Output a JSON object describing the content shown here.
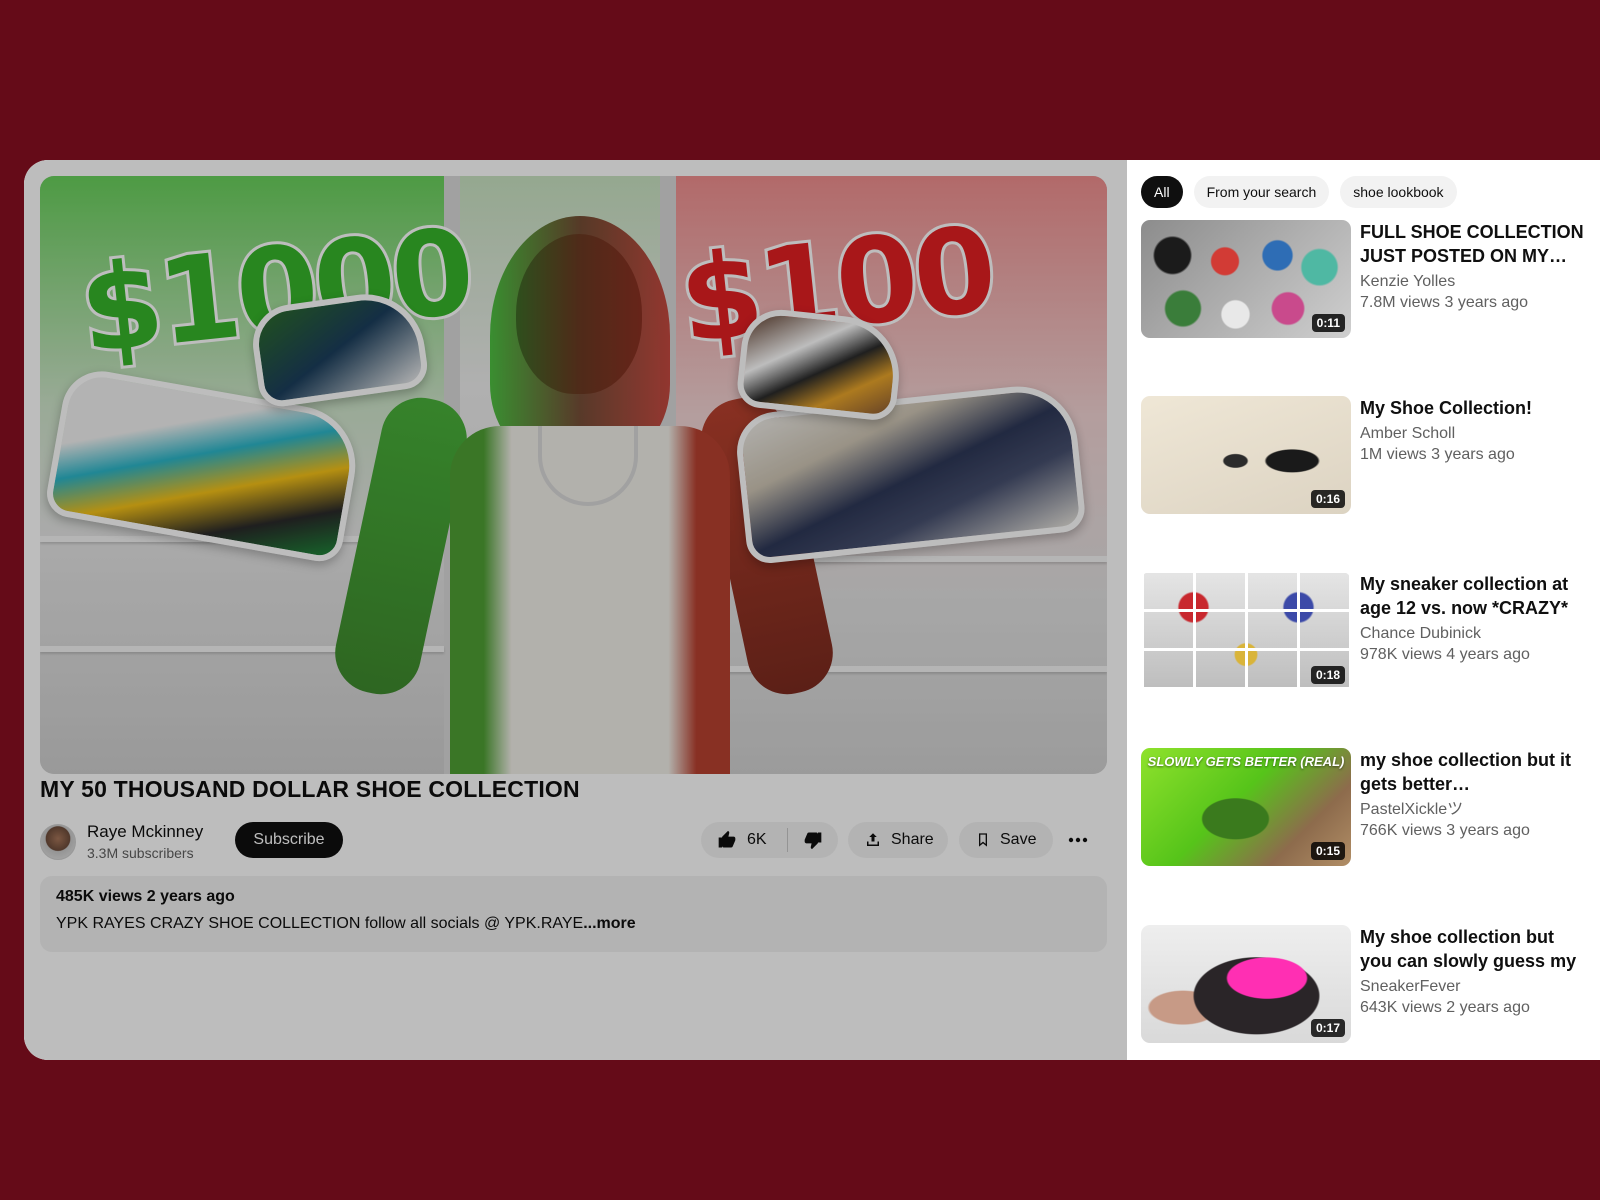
{
  "video": {
    "title": "MY 50 THOUSAND DOLLAR SHOE COLLECTION",
    "channel": "Raye Mckinney",
    "subscribers": "3.3M subscribers",
    "subscribe_label": "Subscribe",
    "likes": "6K",
    "share_label": "Share",
    "save_label": "Save",
    "thumbnail_text_left": "$1000",
    "thumbnail_text_right": "$100"
  },
  "description": {
    "meta": "485K views 2 years ago",
    "text": "YPK RAYES CRAZY SHOE COLLECTION follow all socials @ YPK.RAYE",
    "more_label": "...more"
  },
  "chips": [
    "All",
    "From your search",
    "shoe lookbook"
  ],
  "recommendations": [
    {
      "title": "FULL SHOE COLLECTION JUST POSTED ON MY…",
      "channel": "Kenzie Yolles",
      "stats": "7.8M views 3 years ago",
      "duration": "0:11"
    },
    {
      "title": "My Shoe Collection!",
      "channel": "Amber Scholl",
      "stats": "1M views 3 years ago",
      "duration": "0:16"
    },
    {
      "title": "My sneaker collection at age 12 vs. now *CRAZY*",
      "channel": "Chance Dubinick",
      "stats": "978K views 4 years ago",
      "duration": "0:18"
    },
    {
      "title": "my shoe collection but it gets better…",
      "channel": "PastelXickleツ",
      "stats": "766K views 3 years ago",
      "duration": "0:15",
      "thumb_caption": "SLOWLY GETS BETTER (REAL)"
    },
    {
      "title": "My shoe collection but you can slowly guess my fav…",
      "channel": "SneakerFever",
      "stats": "643K views 2 years ago",
      "duration": "0:17"
    }
  ],
  "colors": {
    "background": "#650b18",
    "subscribe_button": "#0f0f0f",
    "chip_active": "#0f0f0f"
  }
}
